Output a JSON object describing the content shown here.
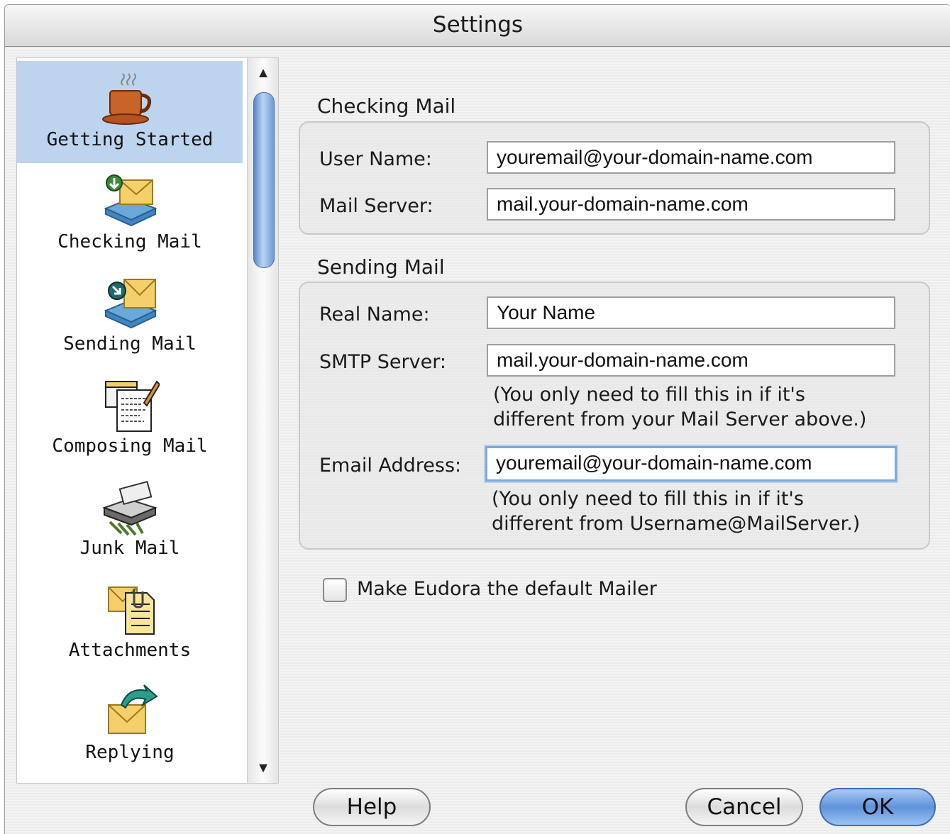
{
  "window": {
    "title": "Settings"
  },
  "sidebar": {
    "items": [
      {
        "label": "Getting Started",
        "icon": "coffee-cup-icon",
        "selected": true
      },
      {
        "label": "Checking Mail",
        "icon": "mail-download-icon",
        "selected": false
      },
      {
        "label": "Sending Mail",
        "icon": "mail-send-icon",
        "selected": false
      },
      {
        "label": "Composing Mail",
        "icon": "compose-document-icon",
        "selected": false
      },
      {
        "label": "Junk Mail",
        "icon": "junk-shredder-icon",
        "selected": false
      },
      {
        "label": "Attachments",
        "icon": "attachment-envelope-icon",
        "selected": false
      },
      {
        "label": "Replying",
        "icon": "reply-envelope-icon",
        "selected": false
      }
    ]
  },
  "checking": {
    "title": "Checking Mail",
    "user_name_label": "User Name:",
    "user_name_value": "youremail@your-domain-name.com",
    "mail_server_label": "Mail Server:",
    "mail_server_value": "mail.your-domain-name.com"
  },
  "sending": {
    "title": "Sending Mail",
    "real_name_label": "Real Name:",
    "real_name_value": "Your Name",
    "smtp_label": "SMTP Server:",
    "smtp_value": "mail.your-domain-name.com",
    "smtp_hint_1": "(You only need to fill this in if it's",
    "smtp_hint_2": "different from your Mail Server above.)",
    "email_label": "Email Address:",
    "email_value": "youremail@your-domain-name.com",
    "email_hint_1": "(You only need to fill this in if it's",
    "email_hint_2": "different from Username@MailServer.)"
  },
  "default_mailer": {
    "label": "Make Eudora the default Mailer",
    "checked": false
  },
  "buttons": {
    "help": "Help",
    "cancel": "Cancel",
    "ok": "OK"
  },
  "colors": {
    "selection": "#bcd4ee",
    "accent": "#5f93dc"
  }
}
